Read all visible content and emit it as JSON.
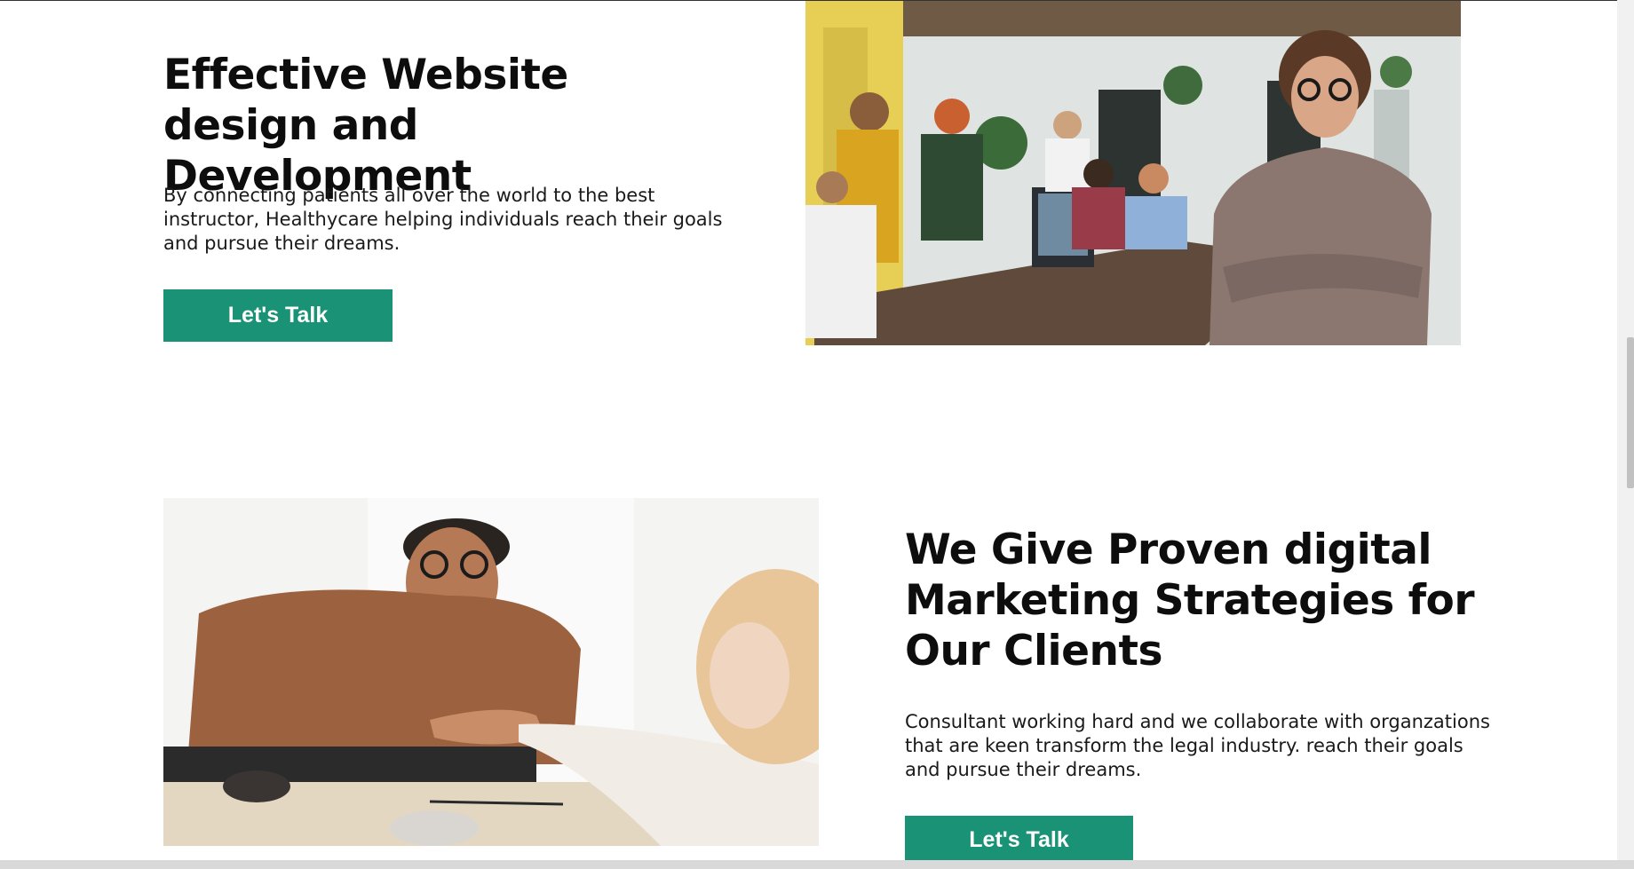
{
  "section_one": {
    "heading": "Effective Website design and Development",
    "body": "By connecting patients all over the world to the best instructor, Healthycare helping individuals reach their goals and pursue their dreams.",
    "cta_label": "Let's Talk",
    "image_alt": "Team meeting in office with smiling woman in front"
  },
  "section_two": {
    "heading": "We Give Proven digital Marketing Strategies for Our Clients",
    "body": "Consultant working hard and we collaborate with organzations that are keen transform the legal industry. reach their goals and pursue their dreams.",
    "cta_label": "Let's Talk",
    "image_alt": "Two people shaking hands across a table"
  },
  "colors": {
    "accent": "#1a9275",
    "text": "#0d0d0d",
    "background": "#ffffff"
  }
}
